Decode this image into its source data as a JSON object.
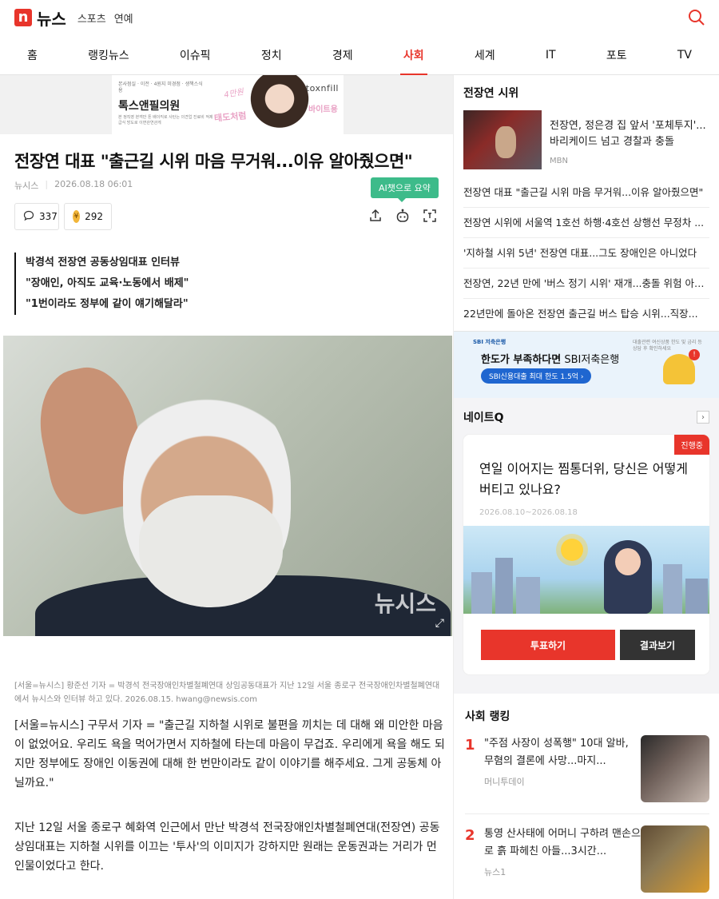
{
  "header": {
    "logo_mark": "n",
    "logo_text": "뉴스",
    "services": [
      "스포츠",
      "연예"
    ]
  },
  "nav": {
    "items": [
      "홈",
      "랭킹뉴스",
      "이슈픽",
      "정치",
      "경제",
      "사회",
      "세계",
      "IT",
      "포토",
      "TV"
    ],
    "active": "사회"
  },
  "ad_top": {
    "fine1": "본사점실 · 이전 · 4원지 미경점 · 생책스식용",
    "title": "톡스앤필의원",
    "fine2": "본 정직영 본객만 톤 배이킥로 사탄는 의견업 진료비 적제급식 방도로 이면관연관게",
    "brand": "toxnfill",
    "script1": "4만원",
    "script2": "태도처럼",
    "script3": "바이트용"
  },
  "article": {
    "title": "전장연 대표 \"출근길 시위 마음 무거워...이유 알아줬으면\"",
    "source": "뉴시스",
    "datetime": "2026.08.18 06:01",
    "ai_summary_label": "AI챗으로 요약",
    "comment_count": "337",
    "like_count": "292",
    "summary": [
      "박경석 전장연 공동상임대표 인터뷰",
      "\"장애인, 아직도 교육·노동에서 배제\"",
      "\"1번이라도 정부에 같이 얘기해달라\""
    ],
    "photo_watermark": "뉴시스",
    "caption": "[서울=뉴시스] 황준선 기자 = 박경석 전국장애인차별철폐연대 상임공동대표가 지난 12일 서울 종로구 전국장애인차별철폐연대에서 뉴시스와 인터뷰 하고 있다. 2026.08.15. hwang@newsis.com",
    "paragraph1": "[서울=뉴시스] 구무서 기자 = \"출근길 지하철 시위로 불편을 끼치는 데 대해 왜 미안한 마음이 없었어요. 우리도 욕을 먹어가면서 지하철에 타는데 마음이 무겁죠. 우리에게 욕을 해도 되지만 정부에도 장애인 이동권에 대해 한 번만이라도 같이 이야기를 해주세요. 그게 공동체 아닐까요.\"",
    "paragraph2": "지난 12일 서울 종로구 혜화역 인근에서 만난 박경석 전국장애인차별철폐연대(전장연) 공동상임대표는 지하철 시위를 이끄는 '투사'의 이미지가 강하지만 원래는 운동권과는 거리가 먼 인물이었다고 한다."
  },
  "sidebar": {
    "topic_title": "전장연 시위",
    "feature": {
      "title": "전장연, 정은경 집 앞서 '포체투지'...바리케이드 넘고 경찰과 충돌",
      "source": "MBN"
    },
    "related": [
      "전장연 대표 \"출근길 시위 마음 무거워...이유 알아줬으면\"",
      "전장연 시위에 서울역 1호선 하행·4호선 상행선 무정차 ...",
      "'지하철 시위 5년' 전장연 대표...그도 장애인은 아니었다",
      "전장연, 22년 만에 '버스 정기 시위' 재개...충돌 위험 아찔...",
      "22년만에 돌아온 전장연 출근길 버스 탑승 시위...직장..."
    ],
    "ad": {
      "brand": "SBI 저축은행",
      "title_bold": "한도가 부족하다면",
      "title_rest": " SBI저축은행",
      "pill": "SBI신용대출 최대 한도 1.5억 ›",
      "fine": "대출관련 여신상품 한도 및 금리 등 상담 후 확인하세요"
    },
    "nateq": {
      "title": "네이트Q",
      "badge": "진행중",
      "question": "연일 이어지는 찜통더위, 당신은 어떻게 버티고 있나요?",
      "dates": "2026.08.10~2026.08.18",
      "vote_label": "투표하기",
      "result_label": "결과보기"
    },
    "ranking": {
      "title": "사회 랭킹",
      "items": [
        {
          "rank": "1",
          "title": "\"주점 사장이 성폭행\" 10대 알바, 무혐의 결론에 사망...마지...",
          "source": "머니투데이"
        },
        {
          "rank": "2",
          "title": "통영 산사태에 어머니 구하려 맨손으로 흙 파헤친 아들...3시간...",
          "source": "뉴스1"
        }
      ]
    }
  },
  "colors": {
    "accent": "#e8352b",
    "ai_green": "#3dbb8a",
    "sbi_blue": "#1f66d0"
  }
}
